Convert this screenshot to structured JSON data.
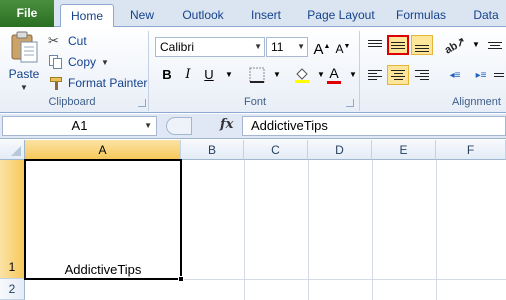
{
  "tabs": [
    "File",
    "Home",
    "New",
    "Outlook",
    "Insert",
    "Page Layout",
    "Formulas",
    "Data"
  ],
  "clipboard": {
    "paste_label": "Paste",
    "cut_label": "Cut",
    "copy_label": "Copy",
    "format_painter_label": "Format Painter",
    "group_label": "Clipboard"
  },
  "font": {
    "family": "Calibri",
    "size": "11",
    "bold": "B",
    "italic": "I",
    "underline": "U",
    "grow": "A",
    "shrink": "A",
    "font_color": "A",
    "group_label": "Font"
  },
  "alignment": {
    "group_label": "Alignment"
  },
  "formula_bar": {
    "name_box": "A1",
    "fx_label": "fx",
    "formula": "AddictiveTips"
  },
  "grid": {
    "columns": [
      "A",
      "B",
      "C",
      "D",
      "E",
      "F"
    ],
    "rows": [
      "1",
      "2"
    ],
    "cell_a1": "AddictiveTips"
  },
  "colors": {
    "file_tab": "#2a6e22",
    "selection": "#f6c85a",
    "highlight_border": "#d00000"
  }
}
